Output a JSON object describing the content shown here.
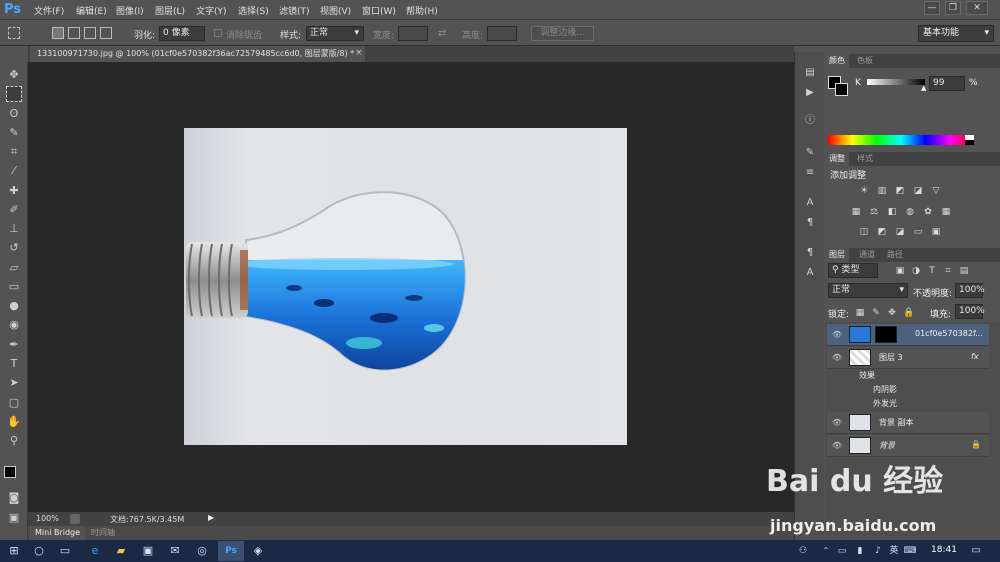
{
  "app": {
    "logo": "Ps"
  },
  "menu": [
    "文件(F)",
    "编辑(E)",
    "图像(I)",
    "图层(L)",
    "文字(Y)",
    "选择(S)",
    "滤镜(T)",
    "视图(V)",
    "窗口(W)",
    "帮助(H)"
  ],
  "window_controls": {
    "minimize": "—",
    "restore": "❐",
    "close": "✕"
  },
  "options_bar": {
    "feather_label": "羽化:",
    "feather_value": "0 像素",
    "antialias_label": "消除锯齿",
    "style_label": "样式:",
    "style_value": "正常",
    "width_label": "宽度:",
    "height_label": "高度:",
    "refine_edge_button": "调整边缘...",
    "workspace": "基本功能"
  },
  "document_tab": {
    "title": "133100971730.jpg @ 100% (01cf0e570382f36ac72579485cc6d0, 图层蒙版/8) *",
    "close": "×"
  },
  "status": {
    "zoom": "100%",
    "doc_info": "文档:767.5K/3.45M"
  },
  "bottom_tabs": [
    "Mini Bridge",
    "时间轴"
  ],
  "color_panel": {
    "tabs": [
      "颜色",
      "色板"
    ],
    "channel": "K",
    "value": "99",
    "unit": "%"
  },
  "adjustments_panel": {
    "tabs": [
      "调整",
      "样式"
    ],
    "title": "添加调整"
  },
  "layers_panel": {
    "tabs": [
      "图层",
      "通道",
      "路径"
    ],
    "filter_kind": "类型",
    "blend_mode": "正常",
    "opacity_label": "不透明度:",
    "opacity_value": "100%",
    "lock_label": "锁定:",
    "fill_label": "填充:",
    "fill_value": "100%",
    "layers": [
      {
        "name": "01cf0e570382f...",
        "selected": true
      },
      {
        "name": "图层 3",
        "fx": "fx"
      },
      {
        "name": "效果"
      },
      {
        "name": "内阴影"
      },
      {
        "name": "外发光"
      },
      {
        "name": "背景 副本"
      },
      {
        "name": "背景",
        "locked": true
      }
    ]
  },
  "taskbar": {
    "clock": "18:41",
    "ime": "英"
  },
  "watermark": {
    "brand": "Bai du 经验",
    "url": "jingyan.baidu.com"
  }
}
